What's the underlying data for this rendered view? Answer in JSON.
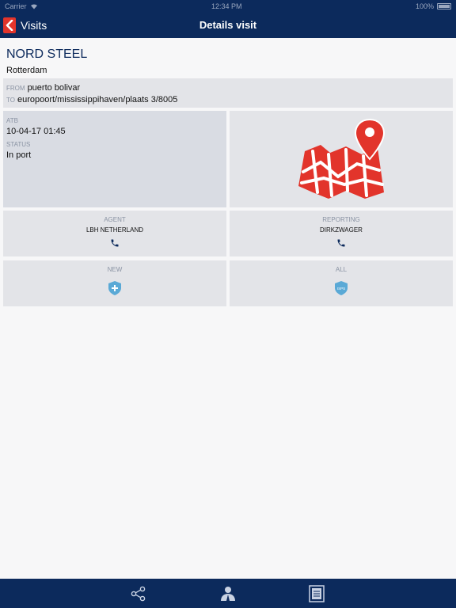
{
  "status_bar": {
    "carrier": "Carrier",
    "time": "12:34 PM",
    "battery": "100%"
  },
  "nav": {
    "back_label": "Visits",
    "title": "Details visit"
  },
  "vessel": {
    "name": "NORD STEEL",
    "city": "Rotterdam"
  },
  "route": {
    "from_label": "FROM",
    "from_value": "puerto bolivar",
    "to_label": "TO",
    "to_value": "europoort/mississippihaven/plaats 3/8005"
  },
  "visit": {
    "atb_label": "ATB",
    "atb_value": "10-04-17 01:45",
    "status_label": "STATUS",
    "status_value": "In port"
  },
  "contacts": {
    "agent_label": "AGENT",
    "agent_name": "LBH NETHERLAND",
    "reporting_label": "REPORTING",
    "reporting_name": "DIRKZWAGER"
  },
  "actions": {
    "new_label": "NEW",
    "all_label": "ALL",
    "all_badge": "ISPS"
  },
  "colors": {
    "navy": "#0c2a5c",
    "accent_red": "#e2342b",
    "cell_bg": "#e3e4e8"
  },
  "icons": [
    "share-icon",
    "people-icon",
    "document-icon",
    "phone-icon",
    "map-pin-icon",
    "shield-icon"
  ]
}
